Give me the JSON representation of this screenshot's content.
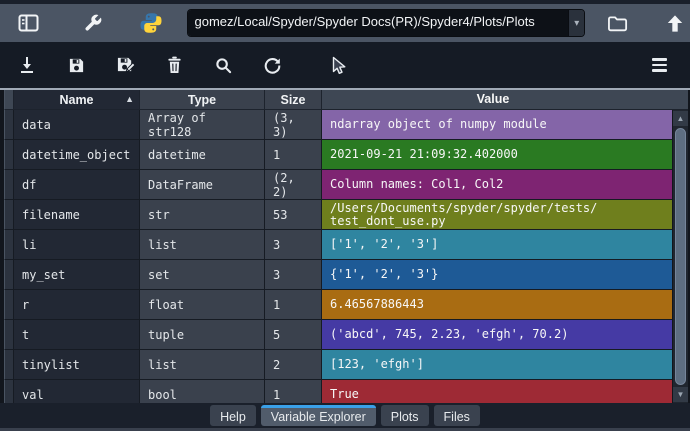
{
  "top_toolbar": {
    "path_value": "gomez/Local/Spyder/Spyder Docs(PR)/Spyder4/Plots/Plots"
  },
  "table": {
    "columns": [
      "Name",
      "Type",
      "Size",
      "Value"
    ],
    "rows": [
      {
        "name": "data",
        "type": "Array of str128",
        "size": "(3, 3)",
        "value": "ndarray object of numpy module",
        "color": "#8465a8"
      },
      {
        "name": "datetime_object",
        "type": "datetime",
        "size": "1",
        "value": "2021-09-21 21:09:32.402000",
        "color": "#2a7a22"
      },
      {
        "name": "df",
        "type": "DataFrame",
        "size": "(2, 2)",
        "value": "Column names: Col1, Col2",
        "color": "#7e2472"
      },
      {
        "name": "filename",
        "type": "str",
        "size": "53",
        "value": "/Users/Documents/spyder/spyder/tests/\ntest_dont_use.py",
        "color": "#6f7f1d"
      },
      {
        "name": "li",
        "type": "list",
        "size": "3",
        "value": "['1', '2', '3']",
        "color": "#2f85a0"
      },
      {
        "name": "my_set",
        "type": "set",
        "size": "3",
        "value": "{'1', '2', '3'}",
        "color": "#1e5a96"
      },
      {
        "name": "r",
        "type": "float",
        "size": "1",
        "value": "6.46567886443",
        "color": "#a96c12"
      },
      {
        "name": "t",
        "type": "tuple",
        "size": "5",
        "value": "('abcd', 745, 2.23, 'efgh', 70.2)",
        "color": "#453aa4"
      },
      {
        "name": "tinylist",
        "type": "list",
        "size": "2",
        "value": "[123, 'efgh']",
        "color": "#2f85a0"
      },
      {
        "name": "val",
        "type": "bool",
        "size": "1",
        "value": "True",
        "color": "#9e2a35"
      }
    ]
  },
  "tabs": {
    "items": [
      {
        "label": "Help",
        "active": false
      },
      {
        "label": "Variable Explorer",
        "active": true
      },
      {
        "label": "Plots",
        "active": false
      },
      {
        "label": "Files",
        "active": false
      }
    ]
  },
  "icons": {
    "combo_caret": "▾",
    "sort_asc": "▲",
    "scroll_up": "▲",
    "scroll_down": "▼",
    "layout_panel": "svg",
    "wrench": "svg",
    "python_logo": "svg",
    "folder_open": "svg",
    "arrow_up": "svg",
    "import_download": "svg",
    "save_floppy": "svg",
    "save_as_floppy_pencil": "svg",
    "trash": "svg",
    "search_magnifier": "svg",
    "refresh_arrow": "svg",
    "menu_hamburger": "bars"
  },
  "colors": {
    "tab_accent": "#3aa0e8",
    "python_blue": "#3776ab",
    "python_yellow": "#ffd43b",
    "toolbar_top_bg": "#4b5564",
    "toolbar_second_bg": "#151b25"
  }
}
